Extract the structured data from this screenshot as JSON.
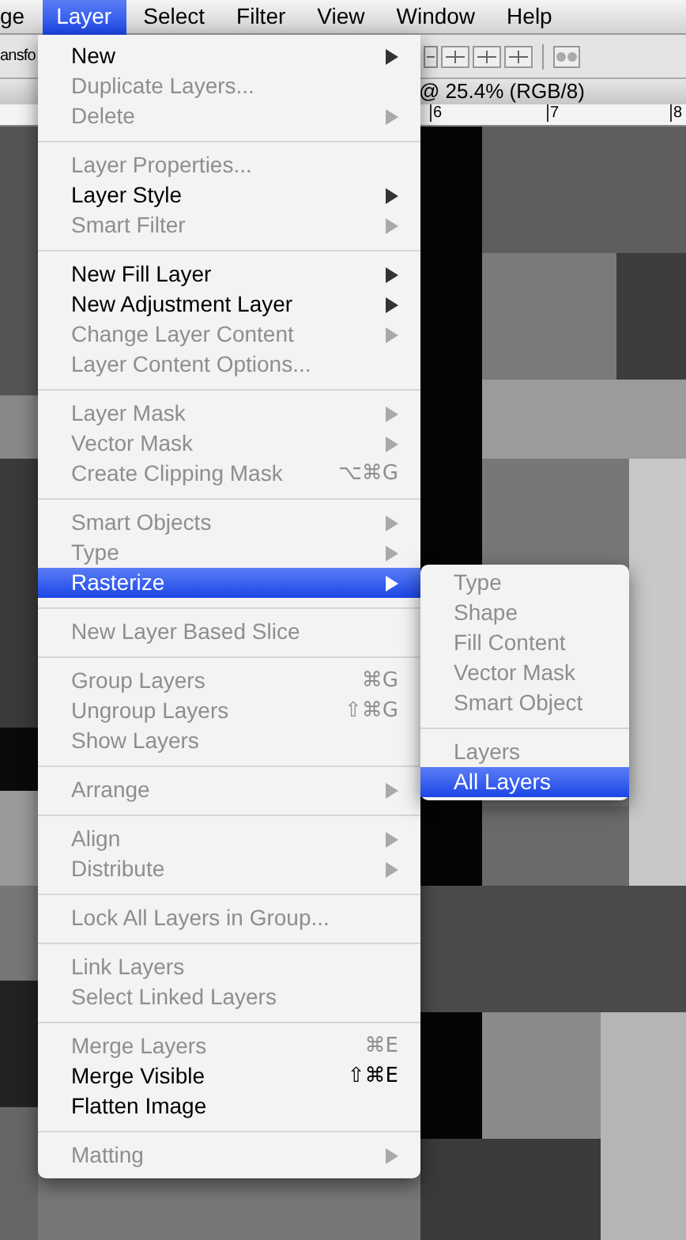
{
  "menu_bar": [
    {
      "label": "ge",
      "selected": false
    },
    {
      "label": "Layer",
      "selected": true
    },
    {
      "label": "Select",
      "selected": false
    },
    {
      "label": "Filter",
      "selected": false
    },
    {
      "label": "View",
      "selected": false
    },
    {
      "label": "Window",
      "selected": false
    },
    {
      "label": "Help",
      "selected": false
    }
  ],
  "toolbar": {
    "text": "ansfo"
  },
  "document_tab": {
    "title": "@ 25.4% (RGB/8)"
  },
  "ruler": {
    "labels": [
      "6",
      "7",
      "8"
    ]
  },
  "layer_menu": {
    "groups": [
      {
        "items": [
          {
            "label": "New",
            "enabled": true,
            "submenu": true,
            "selected": false
          },
          {
            "label": "Duplicate Layers...",
            "enabled": false,
            "submenu": false,
            "selected": false
          },
          {
            "label": "Delete",
            "enabled": false,
            "submenu": true,
            "selected": false
          }
        ]
      },
      {
        "items": [
          {
            "label": "Layer Properties...",
            "enabled": false,
            "submenu": false,
            "selected": false
          },
          {
            "label": "Layer Style",
            "enabled": true,
            "submenu": true,
            "selected": false
          },
          {
            "label": "Smart Filter",
            "enabled": false,
            "submenu": true,
            "selected": false
          }
        ]
      },
      {
        "items": [
          {
            "label": "New Fill Layer",
            "enabled": true,
            "submenu": true,
            "selected": false
          },
          {
            "label": "New Adjustment Layer",
            "enabled": true,
            "submenu": true,
            "selected": false
          },
          {
            "label": "Change Layer Content",
            "enabled": false,
            "submenu": true,
            "selected": false
          },
          {
            "label": "Layer Content Options...",
            "enabled": false,
            "submenu": false,
            "selected": false
          }
        ]
      },
      {
        "items": [
          {
            "label": "Layer Mask",
            "enabled": false,
            "submenu": true,
            "selected": false
          },
          {
            "label": "Vector Mask",
            "enabled": false,
            "submenu": true,
            "selected": false
          },
          {
            "label": "Create Clipping Mask",
            "enabled": false,
            "submenu": false,
            "selected": false,
            "shortcut": "⌥⌘G"
          }
        ]
      },
      {
        "items": [
          {
            "label": "Smart Objects",
            "enabled": false,
            "submenu": true,
            "selected": false
          },
          {
            "label": "Type",
            "enabled": false,
            "submenu": true,
            "selected": false
          },
          {
            "label": "Rasterize",
            "enabled": true,
            "submenu": true,
            "selected": true
          }
        ]
      },
      {
        "items": [
          {
            "label": "New Layer Based Slice",
            "enabled": false,
            "submenu": false,
            "selected": false
          }
        ]
      },
      {
        "items": [
          {
            "label": "Group Layers",
            "enabled": false,
            "submenu": false,
            "selected": false,
            "shortcut": "⌘G"
          },
          {
            "label": "Ungroup Layers",
            "enabled": false,
            "submenu": false,
            "selected": false,
            "shortcut": "⇧⌘G"
          },
          {
            "label": "Show Layers",
            "enabled": false,
            "submenu": false,
            "selected": false
          }
        ]
      },
      {
        "items": [
          {
            "label": "Arrange",
            "enabled": false,
            "submenu": true,
            "selected": false
          }
        ]
      },
      {
        "items": [
          {
            "label": "Align",
            "enabled": false,
            "submenu": true,
            "selected": false
          },
          {
            "label": "Distribute",
            "enabled": false,
            "submenu": true,
            "selected": false
          }
        ]
      },
      {
        "items": [
          {
            "label": "Lock All Layers in Group...",
            "enabled": false,
            "submenu": false,
            "selected": false
          }
        ]
      },
      {
        "items": [
          {
            "label": "Link Layers",
            "enabled": false,
            "submenu": false,
            "selected": false
          },
          {
            "label": "Select Linked Layers",
            "enabled": false,
            "submenu": false,
            "selected": false
          }
        ]
      },
      {
        "items": [
          {
            "label": "Merge Layers",
            "enabled": false,
            "submenu": false,
            "selected": false,
            "shortcut": "⌘E"
          },
          {
            "label": "Merge Visible",
            "enabled": true,
            "submenu": false,
            "selected": false,
            "shortcut": "⇧⌘E"
          },
          {
            "label": "Flatten Image",
            "enabled": true,
            "submenu": false,
            "selected": false
          }
        ]
      },
      {
        "items": [
          {
            "label": "Matting",
            "enabled": false,
            "submenu": true,
            "selected": false
          }
        ]
      }
    ]
  },
  "rasterize_submenu": {
    "groups": [
      {
        "items": [
          {
            "label": "Type",
            "enabled": false,
            "selected": false
          },
          {
            "label": "Shape",
            "enabled": false,
            "selected": false
          },
          {
            "label": "Fill Content",
            "enabled": false,
            "selected": false
          },
          {
            "label": "Vector Mask",
            "enabled": false,
            "selected": false
          },
          {
            "label": "Smart Object",
            "enabled": false,
            "selected": false
          }
        ]
      },
      {
        "items": [
          {
            "label": "Layers",
            "enabled": false,
            "selected": false
          },
          {
            "label": "All Layers",
            "enabled": true,
            "selected": true
          }
        ]
      }
    ]
  }
}
